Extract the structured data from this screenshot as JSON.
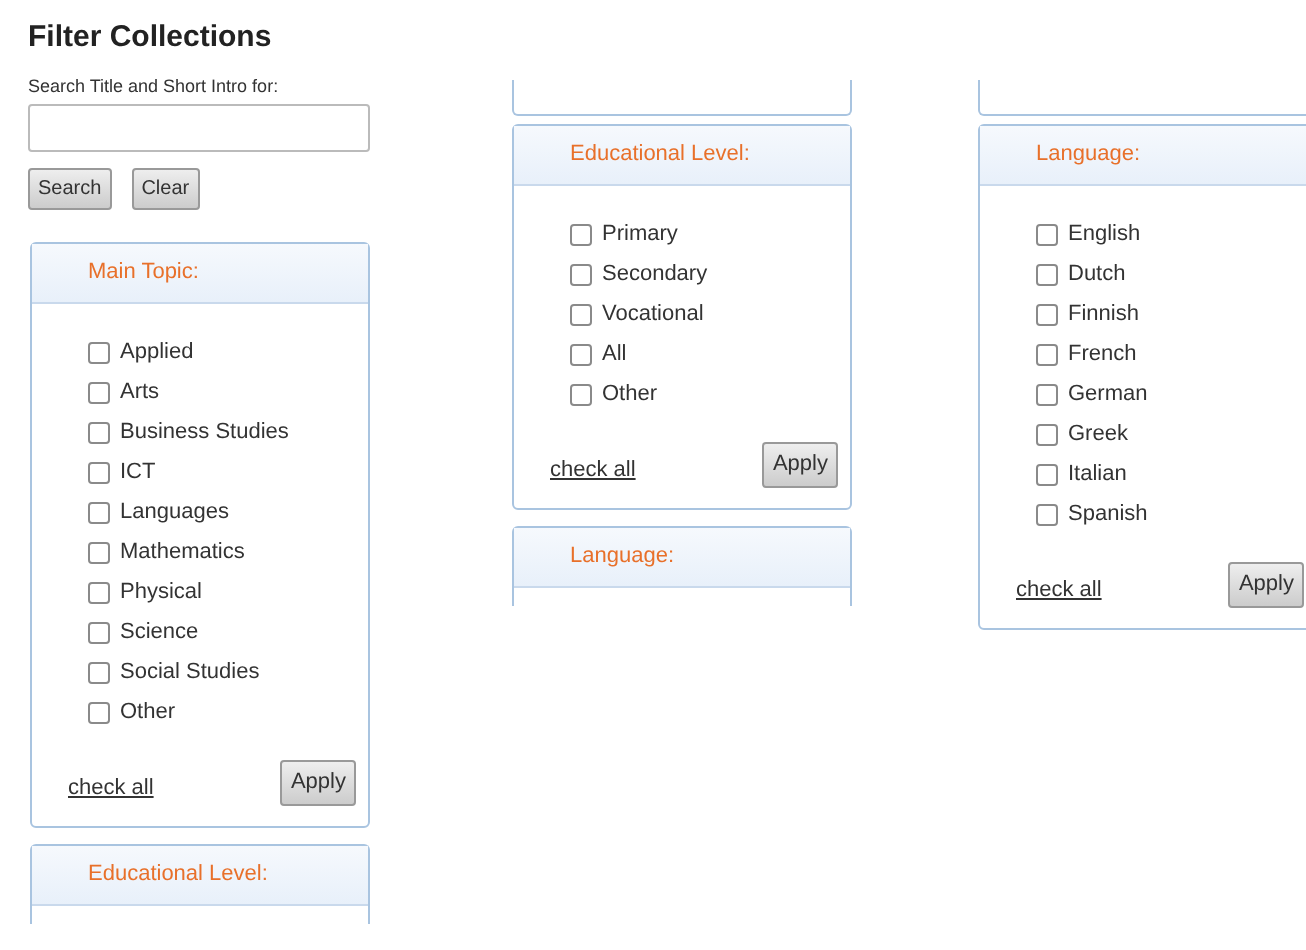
{
  "title": "Filter Collections",
  "search": {
    "label": "Search Title and Short Intro for:",
    "buttons": [
      "Search",
      "Clear"
    ]
  },
  "columns": [
    {
      "panels": [
        {
          "kind": "full",
          "heading": "Main Topic:",
          "options": [
            {
              "label": "Applied",
              "checked": false
            },
            {
              "label": "Arts",
              "checked": false
            },
            {
              "label": "Business Studies",
              "checked": false
            },
            {
              "label": "ICT",
              "checked": false
            },
            {
              "label": "Languages",
              "checked": false
            },
            {
              "label": "Mathematics",
              "checked": false
            },
            {
              "label": "Physical",
              "checked": false
            },
            {
              "label": "Science",
              "checked": false
            },
            {
              "label": "Social Studies",
              "checked": false
            },
            {
              "label": "Other",
              "checked": false
            }
          ],
          "check_all": "check all",
          "apply": "Apply"
        },
        {
          "kind": "header",
          "heading": "Educational Level:"
        }
      ]
    },
    {
      "panels": [
        {
          "kind": "stub"
        },
        {
          "kind": "full",
          "heading": "Educational Level:",
          "options": [
            {
              "label": "Primary",
              "checked": false
            },
            {
              "label": "Secondary",
              "checked": false
            },
            {
              "label": "Vocational",
              "checked": false
            },
            {
              "label": "All",
              "checked": false
            },
            {
              "label": "Other",
              "checked": false
            }
          ],
          "check_all": "check all",
          "apply": "Apply"
        },
        {
          "kind": "header",
          "heading": "Language:"
        }
      ]
    },
    {
      "panels": [
        {
          "kind": "stub"
        },
        {
          "kind": "full",
          "heading": "Language:",
          "options": [
            {
              "label": "English",
              "checked": false
            },
            {
              "label": "Dutch",
              "checked": false
            },
            {
              "label": "Finnish",
              "checked": false
            },
            {
              "label": "French",
              "checked": false
            },
            {
              "label": "German",
              "checked": false
            },
            {
              "label": "Greek",
              "checked": false
            },
            {
              "label": "Italian",
              "checked": false
            },
            {
              "label": "Spanish",
              "checked": false
            }
          ],
          "check_all": "check all",
          "apply": "Apply"
        }
      ]
    }
  ]
}
